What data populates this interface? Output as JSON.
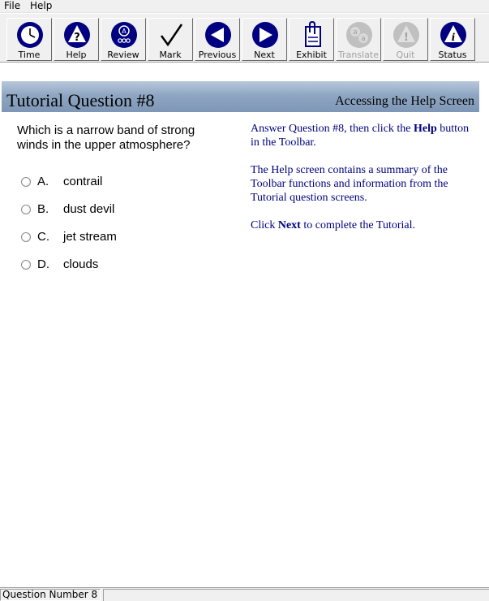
{
  "menu": {
    "file": "File",
    "help": "Help"
  },
  "toolbar": {
    "time": "Time",
    "help": "Help",
    "review": "Review",
    "mark": "Mark",
    "previous": "Previous",
    "next": "Next",
    "exhibit": "Exhibit",
    "translate": "Translate",
    "quit": "Quit",
    "status": "Status"
  },
  "banner": {
    "title": "Tutorial Question #8",
    "subtitle": "Accessing the Help Screen"
  },
  "question": {
    "text": "Which is a narrow band of strong winds in the upper atmosphere?",
    "options": [
      {
        "letter": "A.",
        "text": "contrail"
      },
      {
        "letter": "B.",
        "text": "dust devil"
      },
      {
        "letter": "C.",
        "text": "jet stream"
      },
      {
        "letter": "D.",
        "text": "clouds"
      }
    ]
  },
  "instructions": {
    "p1_pre": "Answer Question #8, then click the ",
    "p1_bold": "Help",
    "p1_post": " button in the Toolbar.",
    "p2": "The Help screen contains a summary of the Toolbar functions and information from the Tutorial question screens.",
    "p3_pre": "Click ",
    "p3_bold": "Next",
    "p3_post": " to complete the Tutorial."
  },
  "statusbar": {
    "question_number": "Question Number 8"
  },
  "colors": {
    "icon_navy": "#000080",
    "instruction_text": "#000080",
    "banner": "#8fa6c2",
    "disabled": "#a0a0a0"
  }
}
